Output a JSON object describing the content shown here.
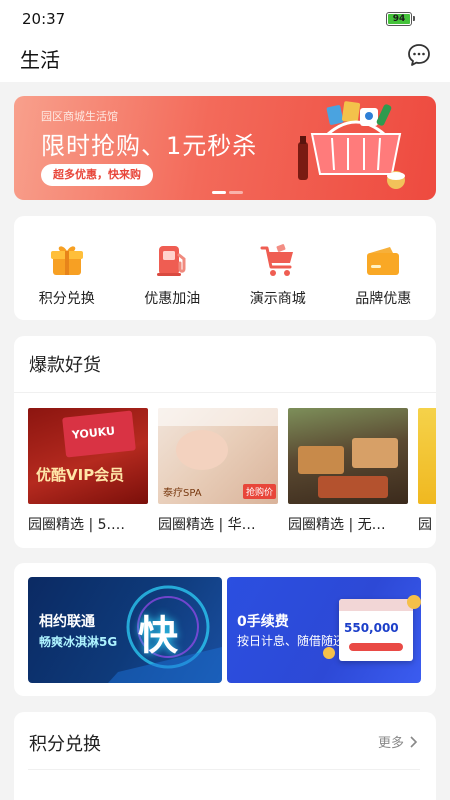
{
  "status_bar": {
    "time": "20:37",
    "battery": "94"
  },
  "header": {
    "title": "生活",
    "message_icon": "chat-bubble-icon"
  },
  "banner": {
    "subtitle": "园区商城生活馆",
    "title": "限时抢购、1元秒杀",
    "pill": "超多优惠，快来购",
    "active_dot": 0
  },
  "quick_menu": [
    {
      "label": "积分兑换",
      "icon": "gift-icon"
    },
    {
      "label": "优惠加油",
      "icon": "fuel-pump-icon"
    },
    {
      "label": "演示商城",
      "icon": "shopping-cart-icon"
    },
    {
      "label": "品牌优惠",
      "icon": "wallet-icon"
    }
  ],
  "hot_goods": {
    "title": "爆款好货",
    "products": [
      {
        "name": "园圈精选 | 5.…",
        "img_text": "优酷VIP会员",
        "img_badge": "YOUKU"
      },
      {
        "name": "园圈精选 | 华…",
        "img_text": "泰疗SPA",
        "img_badge": "抢购价"
      },
      {
        "name": "园圈精选 | 无…"
      },
      {
        "name": "园"
      }
    ]
  },
  "promos": [
    {
      "line1": "相约联通",
      "line2": "畅爽冰淇淋5G",
      "big": "快"
    },
    {
      "line1": "0手续费",
      "line2": "按日计息、随借随还",
      "amount": "550,000"
    }
  ],
  "points": {
    "title": "积分兑换",
    "more": "更多"
  },
  "colors": {
    "accent": "#ee4a3f",
    "background": "#f3f3f3"
  }
}
